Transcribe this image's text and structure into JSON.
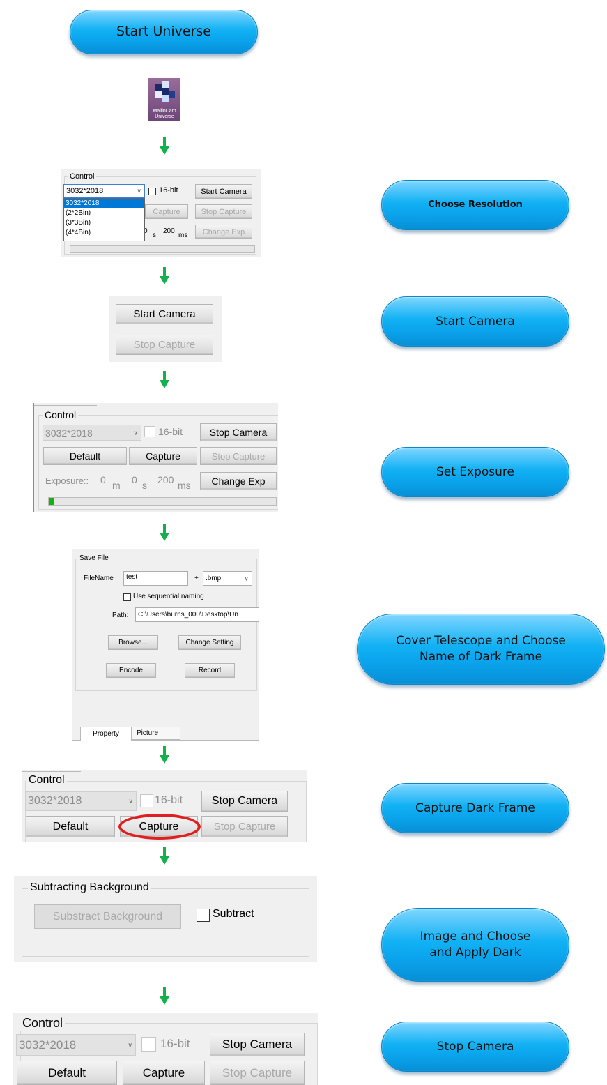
{
  "steps": {
    "start_universe": "Start Universe",
    "choose_resolution": "Choose Resolution",
    "start_camera": "Start Camera",
    "set_exposure": "Set Exposure",
    "cover_telescope": "Cover Telescope and Choose Name of Dark Frame",
    "capture_dark": "Capture Dark Frame",
    "image_apply_dark": "Image and Choose and Apply Dark",
    "stop_camera": "Stop Camera"
  },
  "app_icon": {
    "name": "MallinCam Universe",
    "caption": "MallinCam Universe"
  },
  "control": {
    "group_label": "Control",
    "resolution_value": "3032*2018",
    "resolution_options": [
      "3032*2018",
      "(2*2Bin)",
      "(3*3Bin)",
      "(4*4Bin)"
    ],
    "bit16_label": "16-bit",
    "start_camera": "Start Camera",
    "stop_camera": "Stop Camera",
    "default": "Default",
    "capture": "Capture",
    "stop_capture": "Stop Capture",
    "change_exp": "Change Exp",
    "exposure_label": "Exposure::",
    "exp_min": "0",
    "exp_min_unit": "m",
    "exp_sec": "0",
    "exp_sec_unit": "s",
    "exp_ms": "200",
    "exp_ms_unit": "ms",
    "progress": 0.02
  },
  "save_file": {
    "group_label": "Save File",
    "filename_label": "FileName",
    "filename_value": "test",
    "plus": "+",
    "extension": ".bmp",
    "sequential_label": "Use sequential naming",
    "path_label": "Path:",
    "path_value": "C:\\Users\\burns_000\\Desktop\\Un",
    "browse": "Browse...",
    "change_setting": "Change Setting",
    "encode": "Encode",
    "record": "Record",
    "tab_property": "Property",
    "tab_picture": "Picture"
  },
  "background": {
    "group_label": "Subtracting Background",
    "button": "Substract Background",
    "checkbox_label": "Subtract"
  },
  "colors": {
    "arrow": "#13b04b",
    "pill": "#12b1f4",
    "highlight": "#e02020"
  }
}
